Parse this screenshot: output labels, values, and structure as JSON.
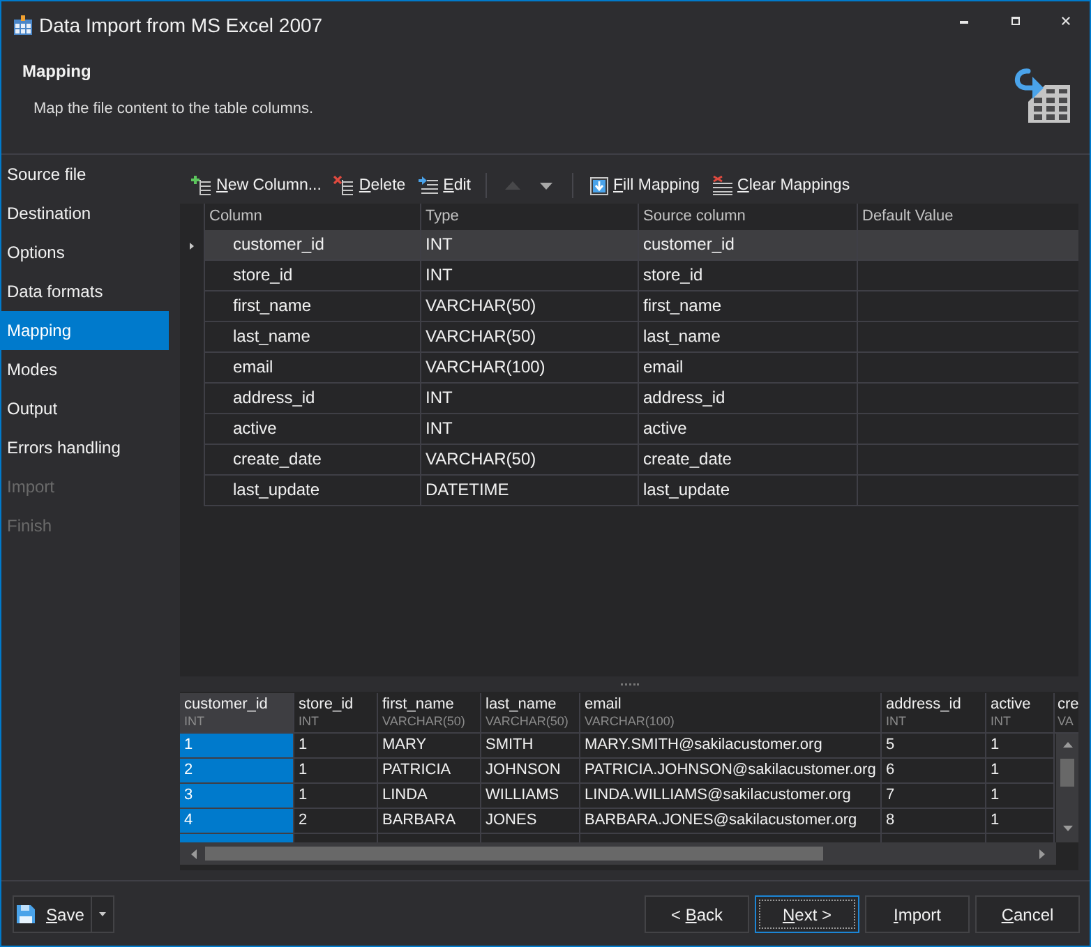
{
  "window": {
    "title": "Data Import from MS Excel 2007"
  },
  "header": {
    "title": "Mapping",
    "description": "Map the file content to the table columns."
  },
  "sidebar": {
    "items": [
      {
        "label": "Source file",
        "selected": false,
        "disabled": false
      },
      {
        "label": "Destination",
        "selected": false,
        "disabled": false
      },
      {
        "label": "Options",
        "selected": false,
        "disabled": false
      },
      {
        "label": "Data formats",
        "selected": false,
        "disabled": false
      },
      {
        "label": "Mapping",
        "selected": true,
        "disabled": false
      },
      {
        "label": "Modes",
        "selected": false,
        "disabled": false
      },
      {
        "label": "Output",
        "selected": false,
        "disabled": false
      },
      {
        "label": "Errors handling",
        "selected": false,
        "disabled": false
      },
      {
        "label": "Import",
        "selected": false,
        "disabled": true
      },
      {
        "label": "Finish",
        "selected": false,
        "disabled": true
      }
    ]
  },
  "toolbar": {
    "items": [
      {
        "kind": "add",
        "label": "New Column...",
        "disabled": false
      },
      {
        "kind": "delete",
        "label": "Delete",
        "disabled": false
      },
      {
        "kind": "edit",
        "label": "Edit",
        "disabled": false
      },
      {
        "kind": "separator"
      },
      {
        "kind": "up",
        "disabled": true
      },
      {
        "kind": "down",
        "disabled": false
      },
      {
        "kind": "separator"
      },
      {
        "kind": "fill",
        "label": "Fill Mapping",
        "disabled": false
      },
      {
        "kind": "clear",
        "label": "Clear Mappings",
        "disabled": false
      }
    ]
  },
  "mapping_grid": {
    "columns": [
      "Column",
      "Type",
      "Source column",
      "Default Value"
    ],
    "rows": [
      {
        "cells": [
          "customer_id",
          "INT",
          "customer_id"
        ],
        "selected": true
      },
      {
        "cells": [
          "store_id",
          "INT",
          "store_id"
        ],
        "selected": false
      },
      {
        "cells": [
          "first_name",
          "VARCHAR(50)",
          "first_name"
        ],
        "selected": false
      },
      {
        "cells": [
          "last_name",
          "VARCHAR(50)",
          "last_name"
        ],
        "selected": false
      },
      {
        "cells": [
          "email",
          "VARCHAR(100)",
          "email"
        ],
        "selected": false
      },
      {
        "cells": [
          "address_id",
          "INT",
          "address_id"
        ],
        "selected": false
      },
      {
        "cells": [
          "active",
          "INT",
          "active"
        ],
        "selected": false
      },
      {
        "cells": [
          "create_date",
          "VARCHAR(50)",
          "create_date"
        ],
        "selected": false
      },
      {
        "cells": [
          "last_update",
          "DATETIME",
          "last_update"
        ],
        "selected": false
      }
    ]
  },
  "preview_grid": {
    "columns": [
      {
        "name": "customer_id",
        "type": "INT",
        "selected": true
      },
      {
        "name": "store_id",
        "type": "INT",
        "selected": false
      },
      {
        "name": "first_name",
        "type": "VARCHAR(50)",
        "selected": false
      },
      {
        "name": "last_name",
        "type": "VARCHAR(50)",
        "selected": false
      },
      {
        "name": "email",
        "type": "VARCHAR(100)",
        "selected": false
      },
      {
        "name": "address_id",
        "type": "INT",
        "selected": false
      },
      {
        "name": "active",
        "type": "INT",
        "selected": false
      },
      {
        "name": "cre",
        "type": "VA",
        "selected": false
      }
    ],
    "rows": [
      [
        "1",
        "1",
        "MARY",
        "SMITH",
        "MARY.SMITH@sakilacustomer.org",
        "5",
        "1"
      ],
      [
        "2",
        "1",
        "PATRICIA",
        "JOHNSON",
        "PATRICIA.JOHNSON@sakilacustomer.org",
        "6",
        "1"
      ],
      [
        "3",
        "1",
        "LINDA",
        "WILLIAMS",
        "LINDA.WILLIAMS@sakilacustomer.org",
        "7",
        "1"
      ],
      [
        "4",
        "2",
        "BARBARA",
        "JONES",
        "BARBARA.JONES@sakilacustomer.org",
        "8",
        "1"
      ]
    ]
  },
  "footer": {
    "save": {
      "label": "Save"
    },
    "buttons": [
      {
        "label": "< Back",
        "focused": false
      },
      {
        "label": "Next >",
        "focused": true
      },
      {
        "label": "Import",
        "focused": false
      },
      {
        "label": "Cancel",
        "focused": false
      }
    ]
  }
}
